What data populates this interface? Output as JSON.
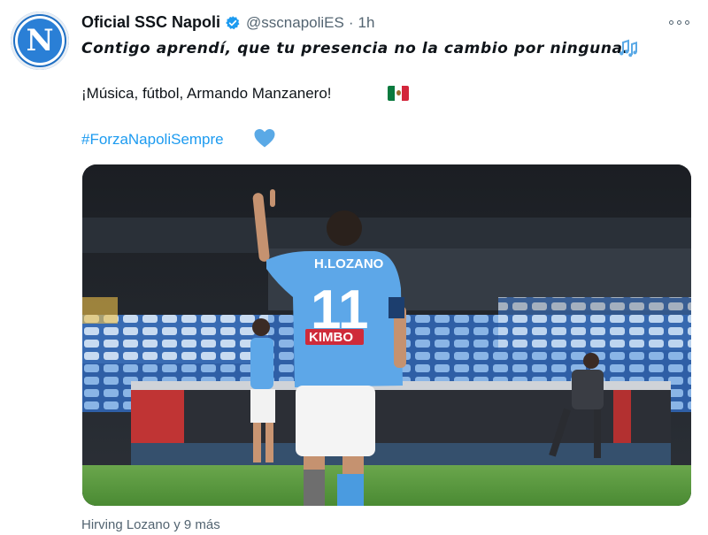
{
  "account": {
    "display_name": "Oficial SSC Napoli",
    "handle": "@sscnapoliES",
    "separator": "·",
    "time": "1h",
    "avatar_letter": "N"
  },
  "tweet": {
    "line1": "Contigo aprendí, que tu presencia no la cambio por ninguna.",
    "line2": "¡Música, fútbol, Armando Manzanero!",
    "hashtag": "#ForzaNapoliSempre"
  },
  "photo": {
    "jersey_name": "H.LOZANO",
    "jersey_number": "11",
    "jersey_sponsor": "KIMBO"
  },
  "tagged": "Hirving Lozano y 9 más",
  "colors": {
    "link": "#1d9bf0",
    "verified": "#1d9bf0",
    "heart": "#5aa9e6",
    "napoli_blue": "#5da7e8",
    "pitch": "#4f9a3a"
  },
  "icons": {
    "verified": "verified-badge-icon",
    "more": "more-options-icon",
    "music": "musical-notes-icon",
    "flag": "mexico-flag-icon",
    "heart": "blue-heart-icon"
  }
}
